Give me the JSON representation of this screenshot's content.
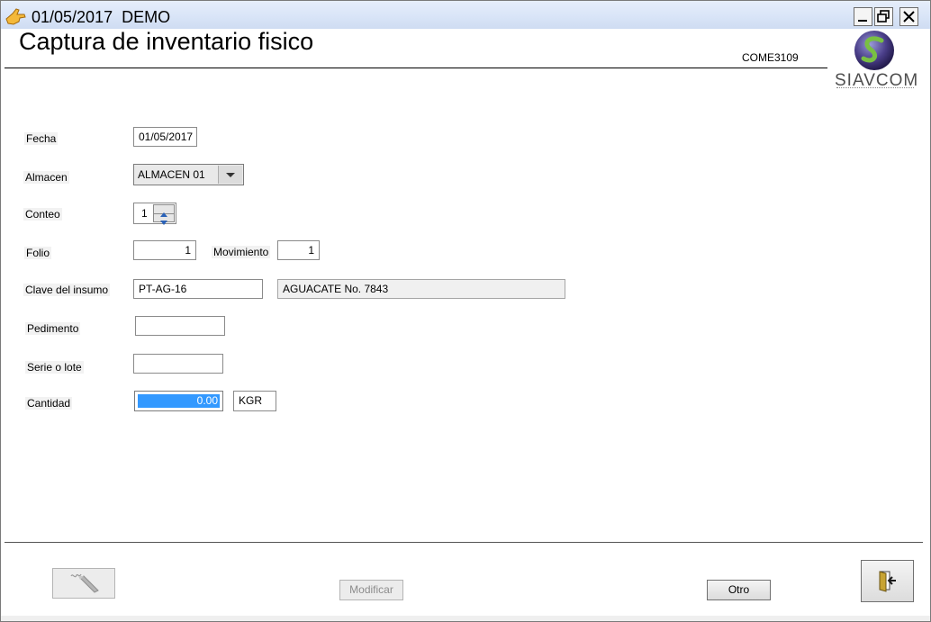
{
  "window": {
    "title": "01/05/2017  DEMO",
    "controls": {
      "minimize": "_",
      "restore": "restore",
      "close": "X"
    }
  },
  "header": {
    "title": "Captura de inventario fisico",
    "program_code": "COME3109",
    "logo_text": "SIAVCOM"
  },
  "form": {
    "fecha": {
      "label": "Fecha",
      "value": "01/05/2017"
    },
    "almacen": {
      "label": "Almacen",
      "value": "ALMACEN 01"
    },
    "conteo": {
      "label": "Conteo",
      "value": "1"
    },
    "folio": {
      "label": "Folio",
      "value": "1"
    },
    "movimiento": {
      "label": "Movimiento",
      "value": "1"
    },
    "clave_insumo": {
      "label": "Clave del insumo",
      "value": "PT-AG-16",
      "description": "AGUACATE No. 7843"
    },
    "pedimento": {
      "label": "Pedimento",
      "value": ""
    },
    "serie_lote": {
      "label": "Serie o lote",
      "value": ""
    },
    "cantidad": {
      "label": "Cantidad",
      "value": "0.00",
      "unit": "KGR"
    }
  },
  "buttons": {
    "modificar": "Modificar",
    "otro": "Otro"
  },
  "icons": {
    "app": "pointing-hand-icon",
    "write": "pen-signature-icon",
    "exit": "exit-door-icon"
  },
  "colors": {
    "titlebar": "#d8e4f7",
    "selection": "#3399ff",
    "readonly_field": "#f0f0f0"
  }
}
